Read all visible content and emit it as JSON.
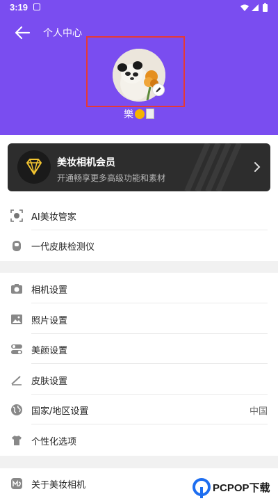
{
  "status": {
    "time": "3:19"
  },
  "header": {
    "title": "个人中心",
    "nickname": "樂"
  },
  "vip": {
    "title": "美妆相机会员",
    "subtitle": "开通畅享更多高级功能和素材"
  },
  "menu": {
    "group1": [
      {
        "label": "AI美妆管家",
        "icon": "ai-scan-icon"
      },
      {
        "label": "一代皮肤检测仪",
        "icon": "skin-detector-icon"
      }
    ],
    "group2": [
      {
        "label": "相机设置",
        "icon": "camera-icon"
      },
      {
        "label": "照片设置",
        "icon": "photo-icon"
      },
      {
        "label": "美颜设置",
        "icon": "toggle-icon"
      },
      {
        "label": "皮肤设置",
        "icon": "skin-pen-icon"
      },
      {
        "label": "国家/地区设置",
        "icon": "globe-icon",
        "value": "中国"
      },
      {
        "label": "个性化选项",
        "icon": "tshirt-icon"
      }
    ],
    "group3": [
      {
        "label": "关于美妆相机",
        "icon": "app-logo-icon"
      }
    ]
  },
  "watermark": {
    "text": "PCPOP下载"
  },
  "colors": {
    "header": "#7a4df0",
    "vip_bg": "#2d2d2d",
    "highlight": "#e53935",
    "gold": "#f3c531"
  }
}
